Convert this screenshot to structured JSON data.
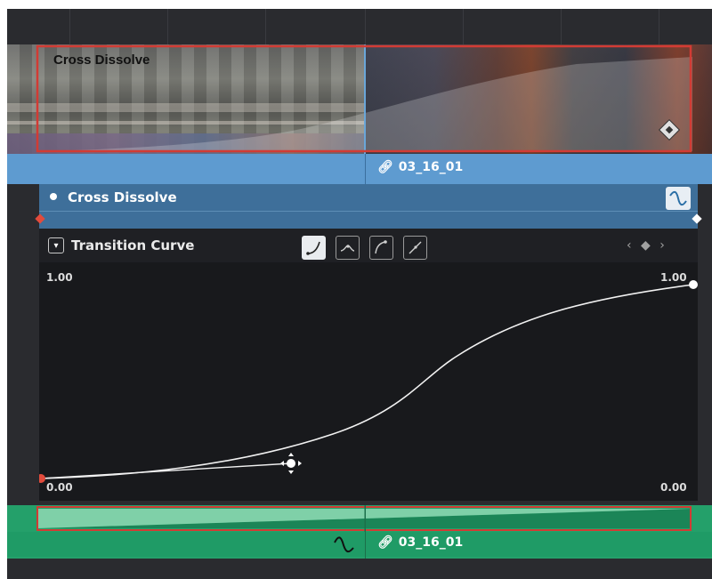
{
  "clip_strip": {
    "title": "Cross Dissolve"
  },
  "video_clip_label": "03_16_01",
  "transition_header": {
    "name": "Cross Dissolve"
  },
  "curve_panel": {
    "title": "Transition Curve",
    "collapse_icon": "▾",
    "shape_buttons": [
      "ease-in",
      "ease-in-out",
      "ease-out",
      "linear"
    ],
    "nav_label": "‹ ◆ ›"
  },
  "graph": {
    "y_max_label": "1.00",
    "y_max_label_right": "1.00",
    "y_min_label": "0.00",
    "y_min_label_right": "0.00"
  },
  "audio_clip_label": "03_16_01",
  "colors": {
    "clip_blue": "#5e9bd0",
    "header_blue": "#3e6f9a",
    "audio_green": "#24a06a",
    "selection_red": "#d23b34"
  }
}
